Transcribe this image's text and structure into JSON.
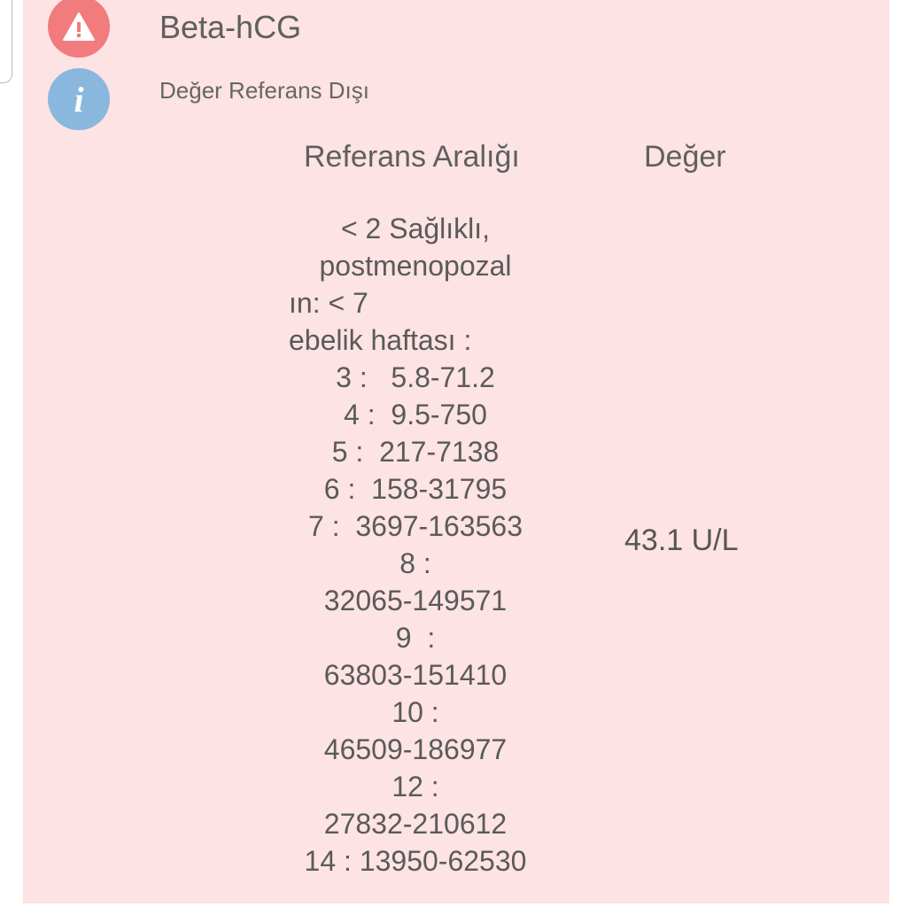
{
  "result": {
    "test_name": "Beta-hCG",
    "status_text": "Değer Referans Dışı",
    "warning_icon": "warning-triangle-icon",
    "info_icon": "info-icon",
    "colors": {
      "card_background": "#fde3e3",
      "warning": "#f27b7d",
      "info": "#8ab7dd"
    }
  },
  "table": {
    "range_header": "Referans Aralığı",
    "value_header": "Değer",
    "range_lines": [
      "< 2 Sağlıklı,",
      "postmenopozal",
      "ın: < 7",
      "ebelik haftası :",
      "3 :   5.8-71.2",
      "4 :  9.5-750",
      "5 :  217-7138",
      "6 :  158-31795",
      "7 :  3697-163563",
      "8 :",
      "32065-149571",
      "9  :",
      "63803-151410",
      "10 :",
      "46509-186977",
      "12 :",
      "27832-210612",
      "14 : 13950-62530"
    ],
    "value": "43.1 U/L"
  }
}
